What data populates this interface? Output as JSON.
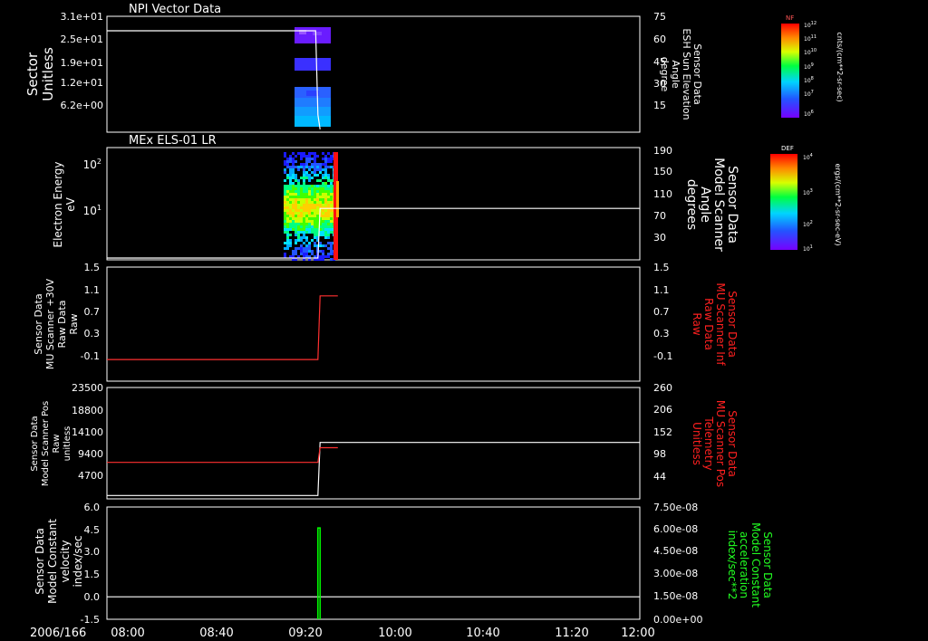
{
  "window": {
    "date_label": "2006/166"
  },
  "time_axis": {
    "ticks": [
      "08:00",
      "08:40",
      "09:20",
      "10:00",
      "10:40",
      "11:20",
      "12:00"
    ]
  },
  "colorbars": [
    {
      "tag": "NF",
      "units": "cnts/(cm**2-sr-sec)",
      "top_label": "10^12",
      "bottom_label": "10^6",
      "mid_labels": [
        "10^11",
        "10^10",
        "10^9",
        "10^8",
        "10^7"
      ]
    },
    {
      "tag": "DEF",
      "units": "ergs/(cm**2-sr-sec-eV)",
      "top_label": "10^4",
      "bottom_label": "10^1",
      "mid_labels": [
        "10^3",
        "10^2"
      ]
    }
  ],
  "chart_data": [
    {
      "type": "heatmap",
      "title": "NPI Vector Data",
      "ylabel": [
        "Sector",
        "Unitless"
      ],
      "y_ticks": [
        "3.1e+01",
        "2.5e+01",
        "1.9e+01",
        "1.2e+01",
        "6.2e+00"
      ],
      "y2label": [
        "Sensor Data",
        "ESH Sun Elevation",
        "Angle",
        "degree"
      ],
      "y2_ticks": [
        "75",
        "60",
        "45",
        "30",
        "15"
      ],
      "series": [
        {
          "name": "ESH Sun Elevation Angle",
          "color": "#ffffff",
          "x": [
            "08:00",
            "09:34",
            "09:35",
            "09:36"
          ],
          "y": [
            70,
            70,
            12,
            2
          ]
        }
      ]
    },
    {
      "type": "heatmap",
      "title": "MEx ELS-01 LR",
      "ylabel": [
        "Electron Energy",
        "eV"
      ],
      "y_ticks": [
        "10^2",
        "10^1"
      ],
      "y2label": [
        "Sensor Data",
        "Model Scanner",
        "Angle",
        "degrees"
      ],
      "y2_ticks": [
        "190",
        "150",
        "110",
        "70",
        "30"
      ],
      "series": [
        {
          "name": "Model Scanner Angle",
          "color": "#ffffff",
          "x": [
            "08:00",
            "09:35",
            "09:36",
            "12:00"
          ],
          "y": [
            3,
            3,
            87,
            87
          ]
        }
      ]
    },
    {
      "type": "line",
      "ylabel": [
        "Sensor Data",
        "MU Scanner +30V",
        "Raw Data",
        "Raw"
      ],
      "y_ticks": [
        "1.5",
        "1.1",
        "0.7",
        "0.3",
        "-0.1"
      ],
      "y2label": [
        "Sensor Data",
        "MU Scanner Inf",
        "Raw Data",
        "Raw"
      ],
      "y2_ticks": [
        "1.5",
        "1.1",
        "0.7",
        "0.3",
        "-0.1"
      ],
      "ylim": [
        -0.4,
        1.5
      ],
      "series": [
        {
          "name": "MU Scanner +30V",
          "color": "#ff3030",
          "x": [
            "08:00",
            "09:35",
            "09:36",
            "09:44"
          ],
          "y": [
            -0.04,
            -0.04,
            1.02,
            1.02
          ]
        }
      ]
    },
    {
      "type": "line",
      "ylabel": [
        "Sensor Data",
        "Model Scanner Pos",
        "Raw",
        "unitless"
      ],
      "y_ticks": [
        "23500",
        "18800",
        "14100",
        "9400",
        "4700"
      ],
      "y2label": [
        "Sensor Data",
        "MU Scanner Pos",
        "Telemetry",
        "Unitless"
      ],
      "y2_ticks": [
        "260",
        "206",
        "152",
        "98",
        "44"
      ],
      "ylim": [
        0,
        23500
      ],
      "series": [
        {
          "name": "Model Scanner Pos",
          "color": "#ffffff",
          "x": [
            "08:00",
            "09:35",
            "09:36",
            "12:00"
          ],
          "y": [
            700,
            700,
            11900,
            11900
          ]
        },
        {
          "name": "MU Scanner Pos",
          "color": "#ff3030",
          "x": [
            "08:00",
            "09:35",
            "09:36",
            "09:44"
          ],
          "y": [
            7700,
            7700,
            10800,
            10800
          ]
        }
      ]
    },
    {
      "type": "line",
      "ylabel": [
        "Sensor Data",
        "Model Constant",
        "velocity",
        "index/sec"
      ],
      "y_ticks": [
        "6.0",
        "4.5",
        "3.0",
        "1.5",
        "0.0",
        "-1.5"
      ],
      "y2label": [
        "Sensor Data",
        "Model Constant",
        "acceleration",
        "index/sec**2"
      ],
      "y2_ticks": [
        "7.50e-08",
        "6.00e-08",
        "4.50e-08",
        "3.00e-08",
        "1.50e-08",
        "0.00e+00"
      ],
      "ylim": [
        -1.5,
        6.0
      ],
      "series": [
        {
          "name": "velocity",
          "color": "#ffffff",
          "x": [
            "08:00",
            "12:00"
          ],
          "y": [
            0.0,
            0.0
          ]
        },
        {
          "name": "acceleration",
          "color": "#00ff00",
          "x": [
            "09:35",
            "09:35",
            "09:36",
            "09:36"
          ],
          "y": [
            -1.5,
            4.6,
            4.6,
            -1.5
          ]
        }
      ]
    }
  ]
}
